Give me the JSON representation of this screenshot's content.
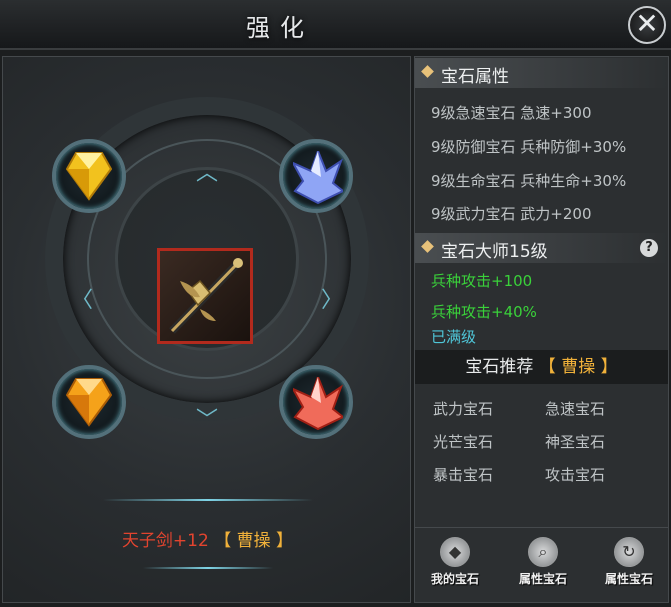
{
  "header": {
    "title": "强化"
  },
  "equipment": {
    "weapon_name": "天子剑+12",
    "owner_label": "【 曹操 】"
  },
  "gem_attributes": {
    "heading": "宝石属性",
    "items": [
      "9级急速宝石 急速+300",
      "9级防御宝石 兵种防御+30%",
      "9级生命宝石 兵种生命+30%",
      "9级武力宝石 武力+200"
    ]
  },
  "gem_master": {
    "heading": "宝石大师15级",
    "help": "?",
    "bonuses": [
      "兵种攻击+100",
      "兵种攻击+40%"
    ],
    "status": "已满级"
  },
  "recommend": {
    "heading": "宝石推荐",
    "hero": "【 曹操 】",
    "gems": [
      "武力宝石",
      "急速宝石",
      "光芒宝石",
      "神圣宝石",
      "暴击宝石",
      "攻击宝石"
    ]
  },
  "buttons": {
    "my_gems": "我的宝石",
    "attr_gem_1": "属性宝石",
    "attr_gem_2": "属性宝石"
  },
  "colors": {
    "red": "#e2442f",
    "gold": "#f0b13a",
    "green": "#3ad13a",
    "cyan": "#4fc6d8"
  },
  "icons": {
    "close": "close-icon",
    "gems": [
      "yellow-gem-icon",
      "blue-crystal-icon",
      "orange-gem-icon",
      "red-crystal-icon"
    ]
  }
}
